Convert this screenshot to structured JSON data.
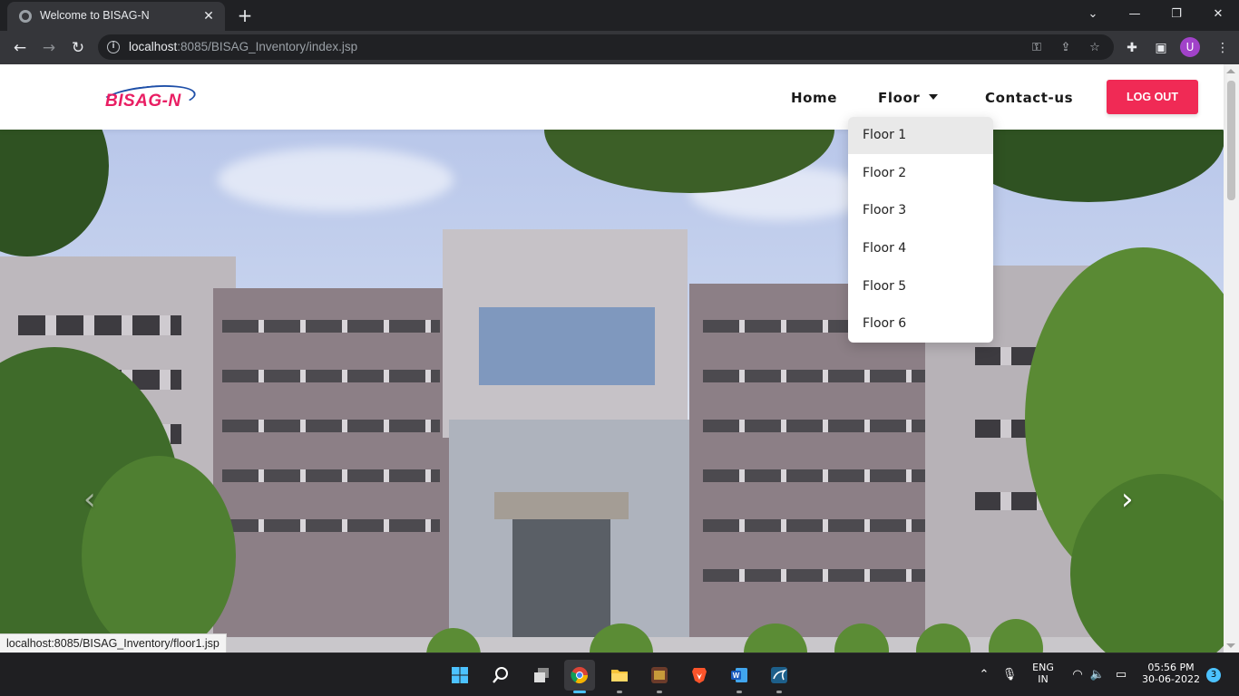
{
  "browser": {
    "tab_title": "Welcome to BISAG-N",
    "tab_close": "✕",
    "new_tab": "+",
    "url_host": "localhost",
    "url_rest": ":8085/BISAG_Inventory/index.jsp",
    "profile_initial": "U",
    "status_url": "localhost:8085/BISAG_Inventory/floor1.jsp"
  },
  "site": {
    "logo_text": "BISAG-N",
    "nav": {
      "home": "Home",
      "floor": "Floor",
      "contact": "Contact-us",
      "logout": "LOG OUT"
    },
    "floor_menu": [
      "Floor 1",
      "Floor 2",
      "Floor 3",
      "Floor 4",
      "Floor 5",
      "Floor 6"
    ],
    "highlighted_item": "Floor 1",
    "carousel": {
      "prev": "‹",
      "next": "›"
    }
  },
  "taskbar": {
    "lang_line1": "ENG",
    "lang_line2": "IN",
    "time": "05:56 PM",
    "date": "30-06-2022",
    "notifications": "3"
  },
  "colors": {
    "accent": "#f02a55",
    "logo": "#e91e63",
    "chrome_dark": "#202124",
    "chrome_toolbar": "#35363a"
  }
}
